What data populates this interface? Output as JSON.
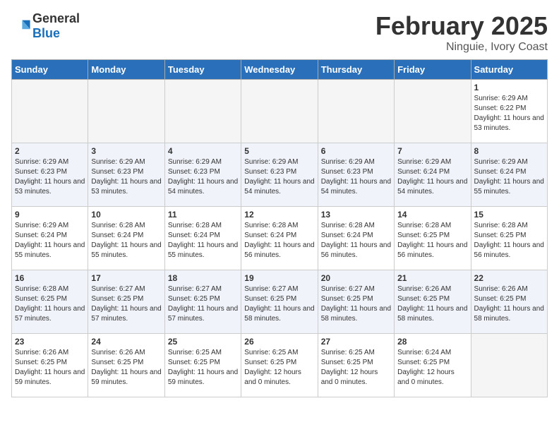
{
  "header": {
    "logo_general": "General",
    "logo_blue": "Blue",
    "month": "February 2025",
    "location": "Ninguie, Ivory Coast"
  },
  "weekdays": [
    "Sunday",
    "Monday",
    "Tuesday",
    "Wednesday",
    "Thursday",
    "Friday",
    "Saturday"
  ],
  "weeks": [
    [
      {
        "day": "",
        "info": ""
      },
      {
        "day": "",
        "info": ""
      },
      {
        "day": "",
        "info": ""
      },
      {
        "day": "",
        "info": ""
      },
      {
        "day": "",
        "info": ""
      },
      {
        "day": "",
        "info": ""
      },
      {
        "day": "1",
        "info": "Sunrise: 6:29 AM\nSunset: 6:22 PM\nDaylight: 11 hours and 53 minutes."
      }
    ],
    [
      {
        "day": "2",
        "info": "Sunrise: 6:29 AM\nSunset: 6:23 PM\nDaylight: 11 hours and 53 minutes."
      },
      {
        "day": "3",
        "info": "Sunrise: 6:29 AM\nSunset: 6:23 PM\nDaylight: 11 hours and 53 minutes."
      },
      {
        "day": "4",
        "info": "Sunrise: 6:29 AM\nSunset: 6:23 PM\nDaylight: 11 hours and 54 minutes."
      },
      {
        "day": "5",
        "info": "Sunrise: 6:29 AM\nSunset: 6:23 PM\nDaylight: 11 hours and 54 minutes."
      },
      {
        "day": "6",
        "info": "Sunrise: 6:29 AM\nSunset: 6:23 PM\nDaylight: 11 hours and 54 minutes."
      },
      {
        "day": "7",
        "info": "Sunrise: 6:29 AM\nSunset: 6:24 PM\nDaylight: 11 hours and 54 minutes."
      },
      {
        "day": "8",
        "info": "Sunrise: 6:29 AM\nSunset: 6:24 PM\nDaylight: 11 hours and 55 minutes."
      }
    ],
    [
      {
        "day": "9",
        "info": "Sunrise: 6:29 AM\nSunset: 6:24 PM\nDaylight: 11 hours and 55 minutes."
      },
      {
        "day": "10",
        "info": "Sunrise: 6:28 AM\nSunset: 6:24 PM\nDaylight: 11 hours and 55 minutes."
      },
      {
        "day": "11",
        "info": "Sunrise: 6:28 AM\nSunset: 6:24 PM\nDaylight: 11 hours and 55 minutes."
      },
      {
        "day": "12",
        "info": "Sunrise: 6:28 AM\nSunset: 6:24 PM\nDaylight: 11 hours and 56 minutes."
      },
      {
        "day": "13",
        "info": "Sunrise: 6:28 AM\nSunset: 6:24 PM\nDaylight: 11 hours and 56 minutes."
      },
      {
        "day": "14",
        "info": "Sunrise: 6:28 AM\nSunset: 6:25 PM\nDaylight: 11 hours and 56 minutes."
      },
      {
        "day": "15",
        "info": "Sunrise: 6:28 AM\nSunset: 6:25 PM\nDaylight: 11 hours and 56 minutes."
      }
    ],
    [
      {
        "day": "16",
        "info": "Sunrise: 6:28 AM\nSunset: 6:25 PM\nDaylight: 11 hours and 57 minutes."
      },
      {
        "day": "17",
        "info": "Sunrise: 6:27 AM\nSunset: 6:25 PM\nDaylight: 11 hours and 57 minutes."
      },
      {
        "day": "18",
        "info": "Sunrise: 6:27 AM\nSunset: 6:25 PM\nDaylight: 11 hours and 57 minutes."
      },
      {
        "day": "19",
        "info": "Sunrise: 6:27 AM\nSunset: 6:25 PM\nDaylight: 11 hours and 58 minutes."
      },
      {
        "day": "20",
        "info": "Sunrise: 6:27 AM\nSunset: 6:25 PM\nDaylight: 11 hours and 58 minutes."
      },
      {
        "day": "21",
        "info": "Sunrise: 6:26 AM\nSunset: 6:25 PM\nDaylight: 11 hours and 58 minutes."
      },
      {
        "day": "22",
        "info": "Sunrise: 6:26 AM\nSunset: 6:25 PM\nDaylight: 11 hours and 58 minutes."
      }
    ],
    [
      {
        "day": "23",
        "info": "Sunrise: 6:26 AM\nSunset: 6:25 PM\nDaylight: 11 hours and 59 minutes."
      },
      {
        "day": "24",
        "info": "Sunrise: 6:26 AM\nSunset: 6:25 PM\nDaylight: 11 hours and 59 minutes."
      },
      {
        "day": "25",
        "info": "Sunrise: 6:25 AM\nSunset: 6:25 PM\nDaylight: 11 hours and 59 minutes."
      },
      {
        "day": "26",
        "info": "Sunrise: 6:25 AM\nSunset: 6:25 PM\nDaylight: 12 hours and 0 minutes."
      },
      {
        "day": "27",
        "info": "Sunrise: 6:25 AM\nSunset: 6:25 PM\nDaylight: 12 hours and 0 minutes."
      },
      {
        "day": "28",
        "info": "Sunrise: 6:24 AM\nSunset: 6:25 PM\nDaylight: 12 hours and 0 minutes."
      },
      {
        "day": "",
        "info": ""
      }
    ]
  ]
}
